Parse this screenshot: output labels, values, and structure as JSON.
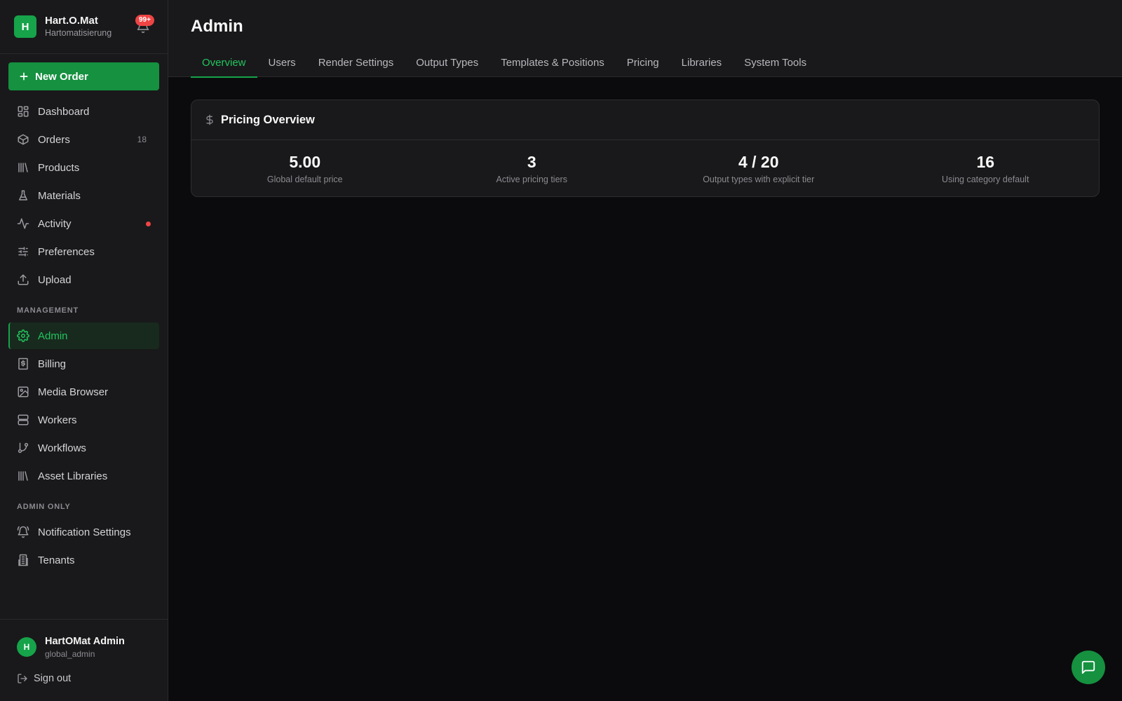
{
  "brand": {
    "logo_letter": "H",
    "name": "Hart.O.Mat",
    "subtitle": "Hartomatisierung",
    "notification_badge": "99+"
  },
  "new_order_label": "New Order",
  "nav": {
    "dashboard": "Dashboard",
    "orders": "Orders",
    "orders_count": "18",
    "products": "Products",
    "materials": "Materials",
    "activity": "Activity",
    "preferences": "Preferences",
    "upload": "Upload"
  },
  "management": {
    "label": "MANAGEMENT",
    "admin": "Admin",
    "billing": "Billing",
    "media_browser": "Media Browser",
    "workers": "Workers",
    "workflows": "Workflows",
    "asset_libraries": "Asset Libraries"
  },
  "admin_only": {
    "label": "ADMIN ONLY",
    "notification_settings": "Notification Settings",
    "tenants": "Tenants"
  },
  "user": {
    "avatar_letter": "H",
    "name": "HartOMat Admin",
    "role": "global_admin",
    "sign_out": "Sign out"
  },
  "page": {
    "title": "Admin",
    "tabs": [
      "Overview",
      "Users",
      "Render Settings",
      "Output Types",
      "Templates & Positions",
      "Pricing",
      "Libraries",
      "System Tools"
    ],
    "active_tab": "Overview"
  },
  "pricing_overview": {
    "title": "Pricing Overview",
    "stats": [
      {
        "value": "5.00",
        "label": "Global default price"
      },
      {
        "value": "3",
        "label": "Active pricing tiers"
      },
      {
        "value": "4 / 20",
        "label": "Output types with explicit tier"
      },
      {
        "value": "16",
        "label": "Using category default"
      }
    ]
  },
  "colors": {
    "accent": "#16a34a",
    "accent_text": "#22c55e",
    "badge": "#ef4444",
    "sidebar_bg": "#19191b",
    "main_bg": "#0b0b0d"
  }
}
